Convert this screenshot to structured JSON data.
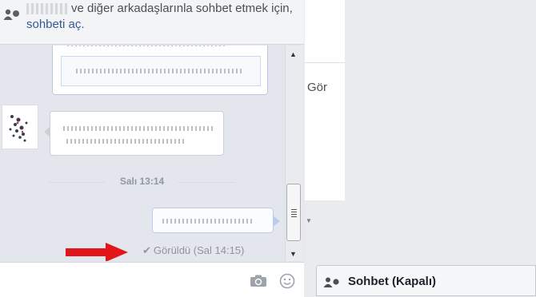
{
  "chat_notice": {
    "text": "ve diğer arkadaşlarınla sohbet etmek için,",
    "link": "sohbeti aç."
  },
  "conversation": {
    "timestamp": "Salı 13:14",
    "seen_status": "Görüldü (Sal 14:15)"
  },
  "side_panel": {
    "see_label": "Gör"
  },
  "chat_bar": {
    "label": "Sohbet (Kapalı)"
  },
  "colors": {
    "accent_link": "#365899",
    "arrow": "#e0161b"
  }
}
